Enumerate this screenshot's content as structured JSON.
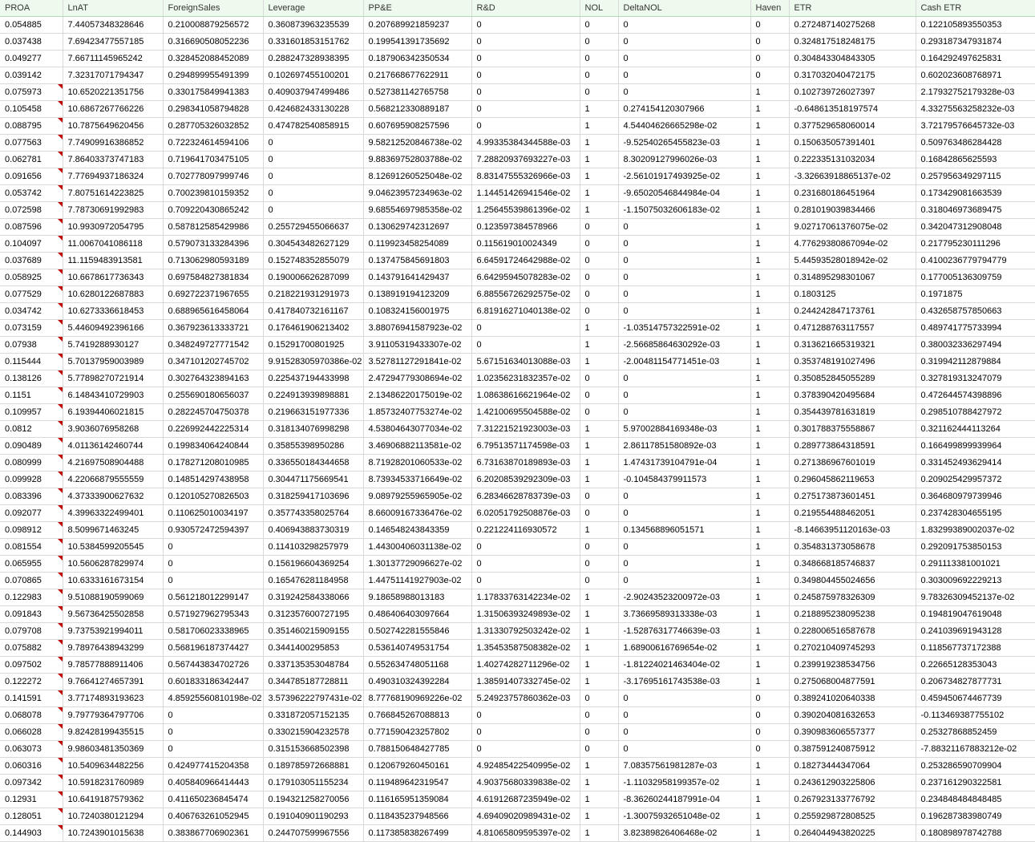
{
  "columns": [
    "PROA",
    "LnAT",
    "ForeignSales",
    "Leverage",
    "PP&E",
    "R&D",
    "NOL",
    "DeltaNOL",
    "Haven",
    "ETR",
    "Cash ETR"
  ],
  "rows": [
    [
      "0.054885",
      "7.44057348328646",
      "0.210008879256572",
      "0.360873963235539",
      "0.207689921859237",
      "0",
      "0",
      "0",
      "0",
      "0.272487140275268",
      "0.122105893550353"
    ],
    [
      "0.037438",
      "7.69423477557185",
      "0.316690508052236",
      "0.331601853151762",
      "0.199541391735692",
      "0",
      "0",
      "0",
      "0",
      "0.324817518248175",
      "0.293187347931874"
    ],
    [
      "0.049277",
      "7.66711145965242",
      "0.328452088452089",
      "0.288247328938395",
      "0.187906342350534",
      "0",
      "0",
      "0",
      "0",
      "0.304843304843305",
      "0.164292497625831"
    ],
    [
      "0.039142",
      "7.32317071794347",
      "0.294899955491399",
      "0.102697455100201",
      "0.217668677622911",
      "0",
      "0",
      "0",
      "0",
      "0.317032040472175",
      "0.602023608768971"
    ],
    [
      "0.075973",
      "10.6520221351756",
      "0.330175849941383",
      "0.409037947499486",
      "0.527381142765758",
      "0",
      "0",
      "0",
      "1",
      "0.102739726027397",
      "2.17932752179328e-03"
    ],
    [
      "0.105458",
      "10.6867267766226",
      "0.298341058794828",
      "0.424682433130228",
      "0.568212330889187",
      "0",
      "1",
      "0.274154120307966",
      "1",
      "-0.648613518197574",
      "4.33275563258232e-03"
    ],
    [
      "0.088795",
      "10.7875649620456",
      "0.287705326032852",
      "0.474782540858915",
      "0.607695908257596",
      "0",
      "1",
      "4.54404626665298e-02",
      "1",
      "0.377529658060014",
      "3.72179576645732e-03"
    ],
    [
      "0.077563",
      "7.74909916386852",
      "0.722324614594106",
      "0",
      "9.58212520846738e-02",
      "4.99335384344588e-03",
      "1",
      "-9.52540265455823e-03",
      "1",
      "0.150635057391401",
      "0.509763486284428"
    ],
    [
      "0.062781",
      "7.86403373747183",
      "0.719641703475105",
      "0",
      "9.88369752803788e-02",
      "7.28820937693227e-03",
      "1",
      "8.30209127996026e-03",
      "1",
      "0.222335131032034",
      "0.16842865625593"
    ],
    [
      "0.091656",
      "7.77694937186324",
      "0.702778097999746",
      "0",
      "8.12691260525048e-02",
      "8.83147555326966e-03",
      "1",
      "-2.56101917493925e-02",
      "1",
      "-3.32663918865137e-02",
      "0.257956349297115"
    ],
    [
      "0.053742",
      "7.80751614223825",
      "0.700239810159352",
      "0",
      "9.04623957234963e-02",
      "1.14451426941546e-02",
      "1",
      "-9.65020546844984e-04",
      "1",
      "0.231680186451964",
      "0.173429081663539"
    ],
    [
      "0.072598",
      "7.78730691992983",
      "0.709220430865242",
      "0",
      "9.68554697985358e-02",
      "1.25645539861396e-02",
      "1",
      "-1.15075032606183e-02",
      "1",
      "0.281019039834466",
      "0.318046973689475"
    ],
    [
      "0.087596",
      "10.9930972054795",
      "0.587812585429986",
      "0.255729455066637",
      "0.130629742312697",
      "0.123597384578966",
      "0",
      "0",
      "1",
      "9.02717061376075e-02",
      "0.342047312908048"
    ],
    [
      "0.104097",
      "11.0067041086118",
      "0.579073133284396",
      "0.304543482627129",
      "0.119923458254089",
      "0.115619010024349",
      "0",
      "0",
      "1",
      "4.77629380867094e-02",
      "0.217795230111296"
    ],
    [
      "0.037689",
      "11.1159483913581",
      "0.713062980593189",
      "0.152748352855079",
      "0.137475845691803",
      "6.64591724642988e-02",
      "0",
      "0",
      "1",
      "5.44593528018942e-02",
      "0.4100236779794779"
    ],
    [
      "0.058925",
      "10.6678617736343",
      "0.697584827381834",
      "0.190006626287099",
      "0.143791641429437",
      "6.64295945078283e-02",
      "0",
      "0",
      "1",
      "0.314895298301067",
      "0.177005136309759"
    ],
    [
      "0.077529",
      "10.6280122687883",
      "0.692722371967655",
      "0.218221931291973",
      "0.138919194123209",
      "6.88556726292575e-02",
      "0",
      "0",
      "1",
      "0.1803125",
      "0.1971875"
    ],
    [
      "0.034742",
      "10.6273336618453",
      "0.688965616458064",
      "0.417840732161167",
      "0.108324156001975",
      "6.81916271040138e-02",
      "0",
      "0",
      "1",
      "0.244242847173761",
      "0.432658757850663"
    ],
    [
      "0.073159",
      "5.44609492396166",
      "0.367923613333721",
      "0.176461906213402",
      "3.88076941587923e-02",
      "0",
      "1",
      "-1.03514757322591e-02",
      "1",
      "0.471288763117557",
      "0.489741775733994"
    ],
    [
      "0.07938",
      "5.7419288930127",
      "0.348249727771542",
      "0.15291700801925",
      "3.91105319433307e-02",
      "0",
      "1",
      "-2.56685864630292e-03",
      "1",
      "0.313621665319321",
      "0.380032336297494"
    ],
    [
      "0.115444",
      "5.70137959003989",
      "0.347101202745702",
      "9.91528305970386e-02",
      "3.52781127291841e-02",
      "5.67151634013088e-03",
      "1",
      "-2.00481154771451e-03",
      "1",
      "0.353748191027496",
      "0.319942112879884"
    ],
    [
      "0.138126",
      "5.77898270721914",
      "0.302764323894163",
      "0.225437194433998",
      "2.47294779308694e-02",
      "1.02356231832357e-02",
      "0",
      "0",
      "1",
      "0.350852845055289",
      "0.327819313247079"
    ],
    [
      "0.1151",
      "6.14843410729903",
      "0.255690180656037",
      "0.224913939898881",
      "2.13486220175019e-02",
      "1.08638616621964e-02",
      "0",
      "0",
      "1",
      "0.378390420495684",
      "0.472644574398896"
    ],
    [
      "0.109957",
      "6.19394406021815",
      "0.282245704750378",
      "0.219663151977336",
      "1.85732407753274e-02",
      "1.42100695504588e-02",
      "0",
      "0",
      "1",
      "0.354439781631819",
      "0.298510788427972"
    ],
    [
      "0.0812",
      "3.9036076958268",
      "0.226992442225314",
      "0.318134076998298",
      "4.53804643077034e-02",
      "7.31221521923003e-03",
      "1",
      "5.97002884169348e-03",
      "1",
      "0.301788375558867",
      "0.321162444113264"
    ],
    [
      "0.090489",
      "4.01136142460744",
      "0.199834064240844",
      "0.35855398950286",
      "3.46906882113581e-02",
      "6.79513571174598e-03",
      "1",
      "2.86117851580892e-03",
      "1",
      "0.289773864318591",
      "0.166499899939964"
    ],
    [
      "0.080999",
      "4.21697508904488",
      "0.178271208010985",
      "0.336550184344658",
      "8.71928201060533e-02",
      "6.73163870189893e-03",
      "1",
      "1.47431739104791e-04",
      "1",
      "0.271386967601019",
      "0.331452493629414"
    ],
    [
      "0.099928",
      "4.22066879555559",
      "0.148514297438958",
      "0.304471175669541",
      "8.73934533716649e-02",
      "6.20208539292309e-03",
      "1",
      "-0.104584379911573",
      "1",
      "0.296045862119653",
      "0.209025429957372"
    ],
    [
      "0.083396",
      "4.37333900627632",
      "0.120105270826503",
      "0.318259417103696",
      "9.08979255965905e-02",
      "6.28346628783739e-03",
      "0",
      "0",
      "1",
      "0.275173873601451",
      "0.364680979739946"
    ],
    [
      "0.092077",
      "4.39963322499401",
      "0.110625010034197",
      "0.357743358025764",
      "8.66009167336476e-02",
      "6.02051792508876e-03",
      "0",
      "0",
      "1",
      "0.219554488462051",
      "0.237428304655195"
    ],
    [
      "0.098912",
      "8.5099671463245",
      "0.930572472594397",
      "0.406943883730319",
      "0.146548243843359",
      "0.221224116930572",
      "1",
      "0.134568896051571",
      "1",
      "-8.14663951120163e-03",
      "1.83299389002037e-02"
    ],
    [
      "0.081554",
      "10.5384599205545",
      "0",
      "0.114103298257979",
      "1.44300406031138e-02",
      "0",
      "0",
      "0",
      "1",
      "0.354831373058678",
      "0.292091753850153"
    ],
    [
      "0.065955",
      "10.5606287829974",
      "0",
      "0.156196604369254",
      "1.30137729096627e-02",
      "0",
      "0",
      "0",
      "1",
      "0.348668185746837",
      "0.291113381001021"
    ],
    [
      "0.070865",
      "10.6333161673154",
      "0",
      "0.165476281184958",
      "1.44751141927903e-02",
      "0",
      "0",
      "0",
      "1",
      "0.349804455024656",
      "0.303009692229213"
    ],
    [
      "0.122983",
      "9.51088190599069",
      "0.561218012299147",
      "0.319242584338066",
      "9.18658988013183",
      "1.17833763142234e-02",
      "1",
      "-2.90243523200972e-03",
      "1",
      "0.245875978326309",
      "9.78326309452137e-02"
    ],
    [
      "0.091843",
      "9.56736425502858",
      "0.571927962795343",
      "0.312357600727195",
      "0.486406403097664",
      "1.31506393249893e-02",
      "1",
      "3.73669589313338e-03",
      "1",
      "0.218895238095238",
      "0.194819047619048"
    ],
    [
      "0.079708",
      "9.73753921994011",
      "0.581706023338965",
      "0.351460215909155",
      "0.502742281555846",
      "1.31330792503242e-02",
      "1",
      "-1.52876317746639e-03",
      "1",
      "0.228006516587678",
      "0.241039691943128"
    ],
    [
      "0.075882",
      "9.78976438943299",
      "0.568196187374427",
      "0.3441400295853",
      "0.536140749531754",
      "1.35453587508382e-02",
      "1",
      "1.68900616769654e-02",
      "1",
      "0.270210409745293",
      "0.118567737172388"
    ],
    [
      "0.097502",
      "9.78577888911406",
      "0.567443834702726",
      "0.337135353048784",
      "0.552634748051168",
      "1.40274282711296e-02",
      "1",
      "-1.81224021463404e-02",
      "1",
      "0.239919238534756",
      "0.22665128353043"
    ],
    [
      "0.122272",
      "9.76641274657391",
      "0.601833186342447",
      "0.344785187728811",
      "0.490310324392284",
      "1.38591407332745e-02",
      "1",
      "-3.17695161743538e-03",
      "1",
      "0.275068004877591",
      "0.206734827877731"
    ],
    [
      "0.141591",
      "3.77174893193623",
      "4.85925560810198e-02",
      "3.57396222797431e-02",
      "8.77768190969226e-02",
      "5.24923757860362e-03",
      "0",
      "0",
      "0",
      "0.389241020640338",
      "0.459450674467739"
    ],
    [
      "0.068078",
      "9.79779364797706",
      "0",
      "0.331872057152135",
      "0.766845267088813",
      "0",
      "0",
      "0",
      "0",
      "0.390204081632653",
      "-0.113469387755102"
    ],
    [
      "0.066028",
      "9.82428199435515",
      "0",
      "0.330215904232578",
      "0.771590423257802",
      "0",
      "0",
      "0",
      "0",
      "0.390983606557377",
      "0.25327868852459"
    ],
    [
      "0.063073",
      "9.98603481350369",
      "0",
      "0.315153668502398",
      "0.788150648427785",
      "0",
      "0",
      "0",
      "0",
      "0.387591240875912",
      "-7.88321167883212e-02"
    ],
    [
      "0.060316",
      "10.5409634482256",
      "0.424977415204358",
      "0.189785972668881",
      "0.120679260450161",
      "4.92485422540995e-02",
      "1",
      "7.08357561981287e-03",
      "1",
      "0.18273444347064",
      "0.253286590709904"
    ],
    [
      "0.097342",
      "10.5918231760989",
      "0.405840966414443",
      "0.179103051155234",
      "0.119489642319547",
      "4.90375680339838e-02",
      "1",
      "-1.11032958199357e-02",
      "1",
      "0.243612903225806",
      "0.237161290322581"
    ],
    [
      "0.12931",
      "10.6419187579362",
      "0.411650236845474",
      "0.194321258270056",
      "0.116165951359084",
      "4.61912687235949e-02",
      "1",
      "-8.36260244187991e-04",
      "1",
      "0.267923133776792",
      "0.234848484848485"
    ],
    [
      "0.128051",
      "10.7240380121294",
      "0.406763261052945",
      "0.191040901190293",
      "0.118435237948566",
      "4.69409020989431e-02",
      "1",
      "-1.30075932651048e-02",
      "1",
      "0.255929872808525",
      "0.196287383980749"
    ],
    [
      "0.144903",
      "10.7243901015638",
      "0.383867706902361",
      "0.244707599967556",
      "0.117385838267499",
      "4.81065809595397e-02",
      "1",
      "3.82389826406468e-02",
      "1",
      "0.264044943820225",
      "0.180898978742788"
    ]
  ]
}
